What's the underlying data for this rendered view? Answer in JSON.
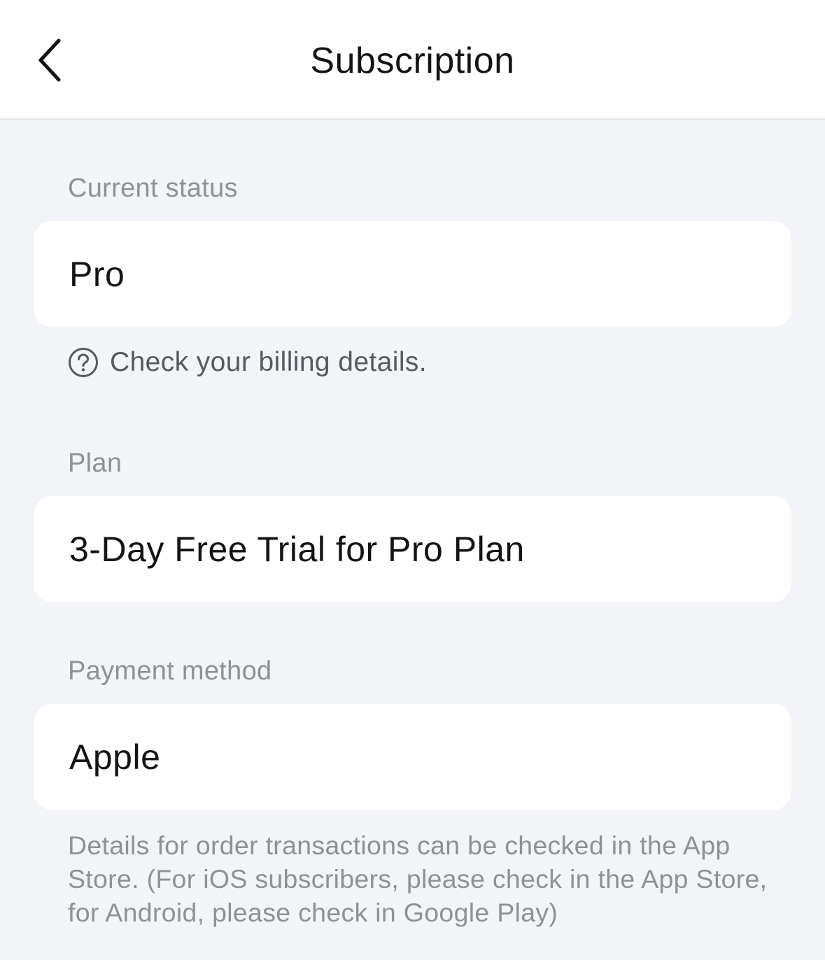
{
  "header": {
    "title": "Subscription",
    "back_icon": "chevron-left-icon"
  },
  "status": {
    "label": "Current status",
    "value": "Pro",
    "help_icon": "question-circle-icon",
    "help_text": "Check your billing details."
  },
  "plan": {
    "label": "Plan",
    "value": "3-Day Free Trial for Pro Plan"
  },
  "payment": {
    "label": "Payment method",
    "value": "Apple",
    "note": "Details for order transactions can be checked in the App Store. (For iOS subscribers, please check in the App Store, for Android, please check in Google Play)"
  },
  "colors": {
    "background": "#f2f4f7",
    "card": "#ffffff",
    "label": "#8e9196",
    "text": "#141414"
  }
}
